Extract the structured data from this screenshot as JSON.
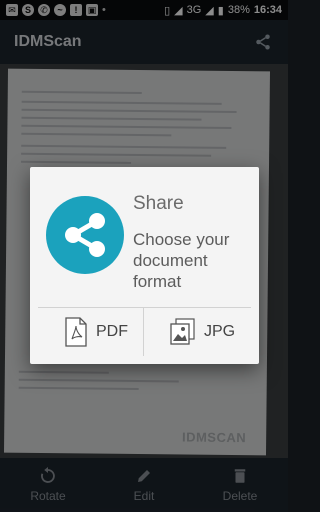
{
  "status": {
    "battery": "38%",
    "network": "3G",
    "time": "16:34"
  },
  "app": {
    "title": "IDMScan"
  },
  "document": {
    "watermark": "IDMSCAN"
  },
  "dialog": {
    "title": "Share",
    "message": "Choose your document format",
    "options": [
      {
        "label": "PDF"
      },
      {
        "label": "JPG"
      }
    ]
  },
  "bottom_bar": {
    "items": [
      {
        "label": "Rotate"
      },
      {
        "label": "Edit"
      },
      {
        "label": "Delete"
      }
    ]
  },
  "colors": {
    "accent": "#1ba2bd",
    "app_bar": "#1d252d"
  }
}
